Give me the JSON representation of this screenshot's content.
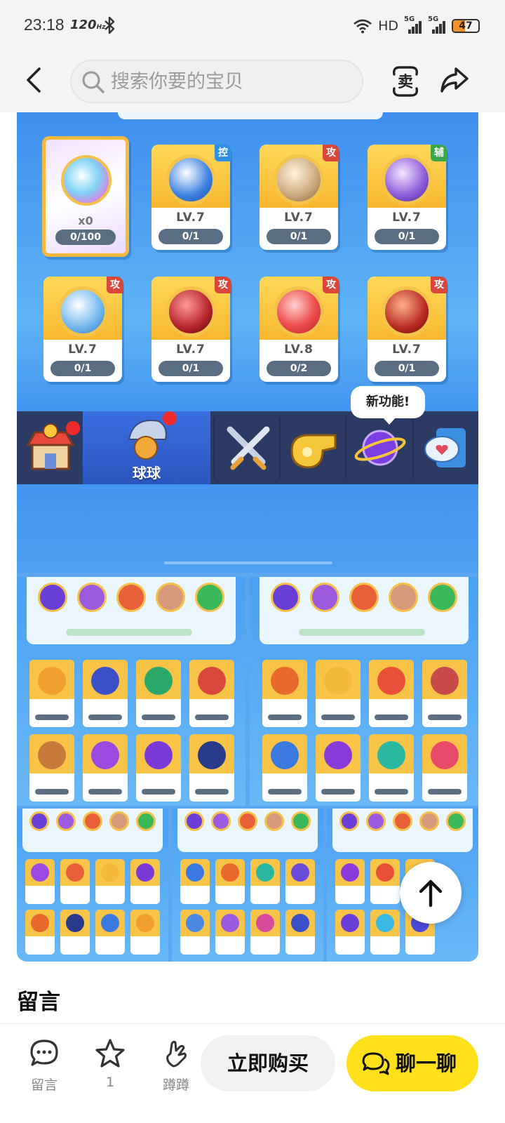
{
  "status_bar": {
    "time": "23:18",
    "refresh_rate": "120",
    "refresh_unit": "Hz",
    "network_label": "HD",
    "sim1": "5G",
    "sim2": "5G",
    "battery": "47",
    "battery_level": 0.47
  },
  "header": {
    "search_placeholder": "搜索你要的宝贝"
  },
  "game_screen": {
    "special_card": {
      "count": "x0",
      "progress": "0/100"
    },
    "cards_row1": [
      {
        "tag": "控",
        "tag_type": "ctl",
        "level": "LV.7",
        "count": "0/1",
        "orb_color": "#3a7fe0"
      },
      {
        "tag": "攻",
        "tag_type": "atk",
        "level": "LV.7",
        "count": "0/1",
        "orb_color": "#c9a77a"
      },
      {
        "tag": "辅",
        "tag_type": "sup",
        "level": "LV.7",
        "count": "0/1",
        "orb_color": "#8a5ad8"
      }
    ],
    "cards_row2": [
      {
        "tag": "攻",
        "tag_type": "atk",
        "level": "LV.7",
        "count": "0/1",
        "orb_color": "#6fb6ee"
      },
      {
        "tag": "攻",
        "tag_type": "atk",
        "level": "LV.7",
        "count": "0/1",
        "orb_color": "#b4222a"
      },
      {
        "tag": "攻",
        "tag_type": "atk",
        "level": "LV.8",
        "count": "0/2",
        "orb_color": "#ee4c4c"
      },
      {
        "tag": "攻",
        "tag_type": "atk",
        "level": "LV.7",
        "count": "0/1",
        "orb_color": "#b82a22"
      }
    ],
    "nav": {
      "selected_label": "球球",
      "new_feature_bubble": "新功能!"
    }
  },
  "comments": {
    "title": "留言"
  },
  "bottom_bar": {
    "comment_label": "留言",
    "favorite_count": "1",
    "nudge_label": "蹲蹲",
    "buy_label": "立即购买",
    "chat_label": "聊一聊"
  }
}
